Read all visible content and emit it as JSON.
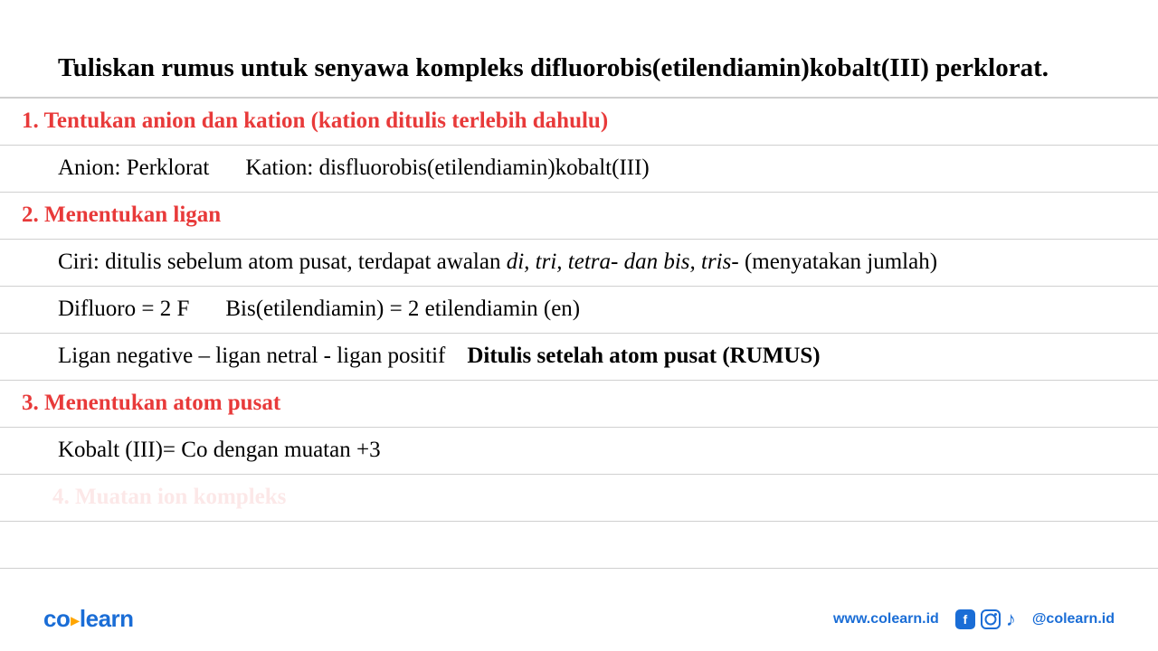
{
  "title": "Tuliskan rumus untuk senyawa kompleks difluorobis(etilendiamin)kobalt(III) perklorat.",
  "steps": {
    "s1": {
      "heading": "1. Tentukan anion dan kation (kation ditulis terlebih dahulu)",
      "anion_label": "Anion: Perklorat",
      "kation_label": "Kation: disfluorobis(etilendiamin)kobalt(III)"
    },
    "s2": {
      "heading": "2. Menentukan ligan",
      "ciri_prefix": "Ciri: ditulis sebelum atom pusat, terdapat awalan ",
      "ciri_italic": "di, tri, tetra- dan bis, tris-",
      "ciri_suffix": " (menyatakan jumlah)",
      "difluoro": "Difluoro = 2 F",
      "bis": "Bis(etilendiamin) = 2 etilendiamin (en)",
      "ligan_order": "Ligan negative – ligan netral - ligan positif",
      "ligan_note": "Ditulis setelah atom pusat (RUMUS)"
    },
    "s3": {
      "heading": "3. Menentukan atom pusat",
      "kobalt": "Kobalt (III)= Co dengan muatan +3"
    },
    "s4": {
      "faded": "4. Muatan ion kompleks"
    }
  },
  "footer": {
    "logo_co": "co",
    "logo_learn": "learn",
    "website": "www.colearn.id",
    "handle": "@colearn.id"
  }
}
